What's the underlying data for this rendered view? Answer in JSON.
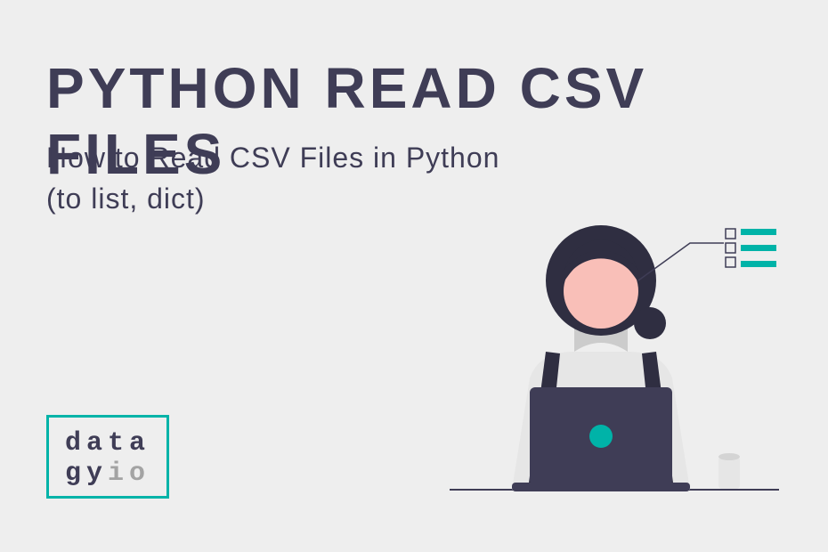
{
  "heading": {
    "title": "PYTHON READ CSV FILES",
    "subtitle": "How to Read CSV Files in Python\n(to list, dict)"
  },
  "logo": {
    "line1": "data",
    "line2_a": "gy",
    "line2_b": "io"
  },
  "colors": {
    "bg": "#eeeeee",
    "dark": "#3f3d56",
    "dark2": "#2f2e41",
    "teal": "#00b3a8",
    "skin": "#f9bfb8",
    "gray": "#cccccc",
    "light": "#e6e6e6"
  }
}
